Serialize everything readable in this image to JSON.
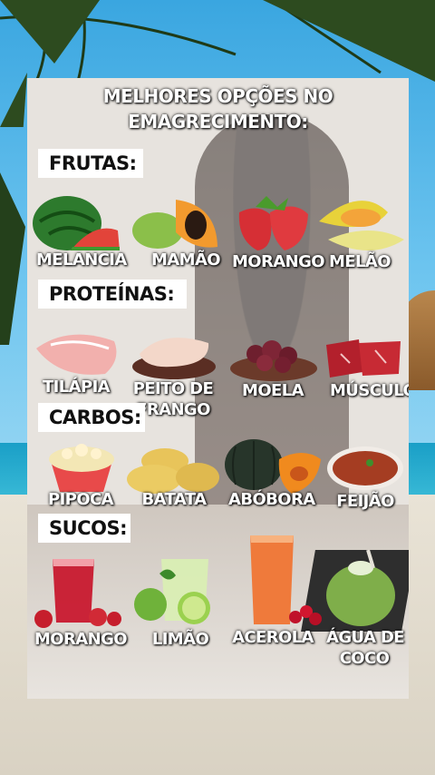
{
  "title_line1": "MELHORES OPÇÕES NO",
  "title_line2": "EMAGRECIMENTO:",
  "sections": {
    "frutas": "FRUTAS:",
    "proteinas": "PROTEÍNAS:",
    "carbos": "CARBOS:",
    "sucos": "SUCOS:"
  },
  "frutas": [
    "MELANCIA",
    "MAMÃO",
    "MORANGO",
    "MELÃO"
  ],
  "proteinas": [
    "TILÁPIA",
    "PEITO DE",
    "FRANGO",
    "MOELA",
    "MÚSCULO"
  ],
  "carbos": [
    "PIPOCA",
    "BATATA",
    "ABÓBORA",
    "FEIJÃO"
  ],
  "sucos": [
    "MORANGO",
    "LIMÃO",
    "ACEROLA",
    "ÁGUA DE",
    "COCO"
  ],
  "colors": {
    "sky": "#3aa6e0",
    "sea": "#1a9fc7",
    "sand": "#e9e3d6",
    "card": "#e7e3de",
    "label_text": "#ffffff",
    "section_bg": "#ffffff"
  },
  "icons": [
    "palm-leaves",
    "watermelon",
    "papaya",
    "strawberry",
    "melon",
    "tilapia",
    "chicken-breast",
    "gizzard",
    "beef",
    "popcorn",
    "potato",
    "pumpkin",
    "beans",
    "strawberry-juice",
    "lime-juice",
    "acerola-juice",
    "coconut"
  ]
}
